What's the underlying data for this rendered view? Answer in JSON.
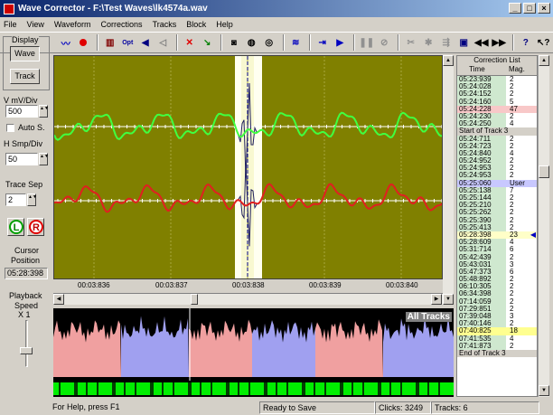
{
  "window": {
    "title": "Wave Corrector - F:\\Test Waves\\lk4574a.wav"
  },
  "menu": [
    "File",
    "View",
    "Waveform",
    "Corrections",
    "Tracks",
    "Block",
    "Help"
  ],
  "toolbar": {
    "icons": [
      "waveform-icon",
      "record-icon",
      "play-options-icon",
      "opt-icon",
      "speaker-icon",
      "volume-icon",
      "cross-icon",
      "wand-icon",
      "binoculars-icon",
      "find-prev-icon",
      "find-next-icon",
      "filter-icon",
      "jump-icon",
      "play-icon",
      "pause-icon",
      "stop-icon",
      "cut-icon",
      "split-icon",
      "merge-icon",
      "window-icon",
      "prev-track-icon",
      "next-track-icon",
      "help-icon",
      "context-help-icon"
    ],
    "opt_label": "Opt"
  },
  "left": {
    "display_label": "Display",
    "wave_btn": "Wave",
    "track_btn": "Track",
    "vmv_label": "V mV/Div",
    "vmv_value": "500",
    "autos_label": "Auto S.",
    "hsmp_label": "H Smp/Div",
    "hsmp_value": "50",
    "tracksep_label": "Trace Sep",
    "tracksep_value": "2",
    "l_label": "L",
    "r_label": "R",
    "cursor_label1": "Cursor",
    "cursor_label2": "Position",
    "cursor_value": "05:28:398",
    "playback_label1": "Playback",
    "playback_label2": "Speed",
    "playback_value": "X 1"
  },
  "time_axis": [
    "00:03:836",
    "00:03:837",
    "00:03:838",
    "00:03:839",
    "00:03:840"
  ],
  "overview": {
    "label": "All Tracks"
  },
  "corrections": {
    "header1": "Correction List",
    "header_time": "Time",
    "header_mag": "Mag.",
    "rows": [
      {
        "t": "05:23:939",
        "m": "2",
        "k": ""
      },
      {
        "t": "05:24:028",
        "m": "2",
        "k": ""
      },
      {
        "t": "05:24:152",
        "m": "2",
        "k": ""
      },
      {
        "t": "05:24:160",
        "m": "5",
        "k": ""
      },
      {
        "t": "05:24:228",
        "m": "47",
        "k": "hot"
      },
      {
        "t": "05:24:230",
        "m": "2",
        "k": ""
      },
      {
        "t": "05:24:250",
        "m": "4",
        "k": ""
      },
      {
        "t": "Start of Track 3",
        "m": "",
        "k": "track"
      },
      {
        "t": "05:24:711",
        "m": "2",
        "k": ""
      },
      {
        "t": "05:24:723",
        "m": "2",
        "k": ""
      },
      {
        "t": "05:24:840",
        "m": "4",
        "k": ""
      },
      {
        "t": "05:24:952",
        "m": "2",
        "k": ""
      },
      {
        "t": "05:24:953",
        "m": "2",
        "k": ""
      },
      {
        "t": "05:24:953",
        "m": "2",
        "k": ""
      },
      {
        "t": "05:25:060",
        "m": "User",
        "k": "user"
      },
      {
        "t": "05:25:138",
        "m": "7",
        "k": ""
      },
      {
        "t": "05:25:144",
        "m": "2",
        "k": ""
      },
      {
        "t": "05:25:210",
        "m": "2",
        "k": ""
      },
      {
        "t": "05:25:262",
        "m": "2",
        "k": ""
      },
      {
        "t": "05:25:390",
        "m": "2",
        "k": ""
      },
      {
        "t": "05:25:413",
        "m": "2",
        "k": ""
      },
      {
        "t": "05:28:398",
        "m": "23",
        "k": "sel"
      },
      {
        "t": "05:28:609",
        "m": "4",
        "k": ""
      },
      {
        "t": "05:31:714",
        "m": "6",
        "k": ""
      },
      {
        "t": "05:42:439",
        "m": "2",
        "k": ""
      },
      {
        "t": "05:43:031",
        "m": "3",
        "k": ""
      },
      {
        "t": "05:47:373",
        "m": "6",
        "k": ""
      },
      {
        "t": "05:48:892",
        "m": "2",
        "k": ""
      },
      {
        "t": "06:10:305",
        "m": "2",
        "k": ""
      },
      {
        "t": "06:34:398",
        "m": "2",
        "k": ""
      },
      {
        "t": "07:14:059",
        "m": "2",
        "k": ""
      },
      {
        "t": "07:29:851",
        "m": "2",
        "k": ""
      },
      {
        "t": "07:39:048",
        "m": "3",
        "k": ""
      },
      {
        "t": "07:40:146",
        "m": "2",
        "k": ""
      },
      {
        "t": "07:40:825",
        "m": "18",
        "k": "yel"
      },
      {
        "t": "07:41:535",
        "m": "4",
        "k": ""
      },
      {
        "t": "07:41:873",
        "m": "2",
        "k": ""
      },
      {
        "t": "End of Track 3",
        "m": "",
        "k": "track"
      }
    ]
  },
  "status": {
    "help": "For Help, press F1",
    "ready": "Ready to Save",
    "clicks": "Clicks: 3249",
    "tracks": "Tracks: 6"
  },
  "colors": {
    "plot_bg": "#808000",
    "green_trace": "#40ff40",
    "red_trace": "#e02020",
    "highlight": "#fffff0",
    "pink": "#f0a0a0",
    "blue": "#a0a0f0"
  }
}
